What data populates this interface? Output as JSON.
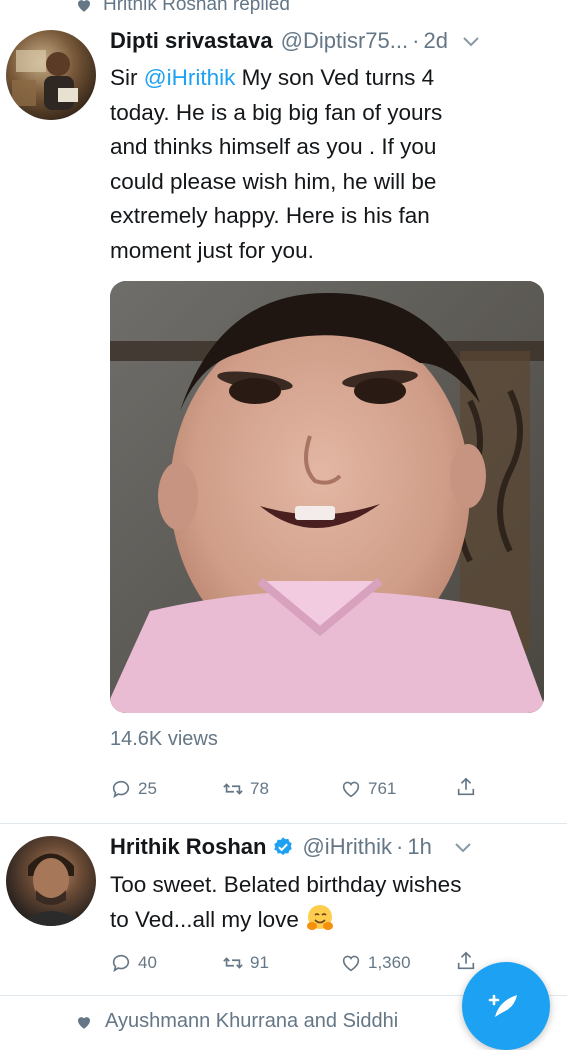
{
  "context": {
    "label": "Hrithik Roshan replied"
  },
  "tweet1": {
    "name": "Dipti srivastava",
    "handle": "@Diptisr75...",
    "time": "2d",
    "text_before": "Sir ",
    "mention": "@iHrithik",
    "text_line1_rest": " My son Ved turns 4",
    "text_line2": "today. He is a big big fan of yours",
    "text_line3": "and thinks himself as you . If you",
    "text_line4": "could please wish him, he will be",
    "text_line5": "extremely happy. Here is his fan",
    "text_line6": "moment just for you.",
    "views": "14.6K views",
    "replies": "25",
    "retweets": "78",
    "likes": "761"
  },
  "tweet2": {
    "name": "Hrithik Roshan",
    "handle": "@iHrithik",
    "time": "1h",
    "text_line1": "Too sweet. Belated birthday wishes",
    "text_line2": "to Ved...all my love",
    "replies": "40",
    "retweets": "91",
    "likes": "1,360"
  },
  "footer": {
    "label": "Ayushmann Khurrana and Siddhi"
  },
  "colors": {
    "accent": "#1da1f2",
    "muted": "#657786",
    "text": "#14171a"
  },
  "icons": [
    "heart-icon",
    "chevron-down-icon",
    "reply-icon",
    "retweet-icon",
    "like-icon",
    "share-icon",
    "verified-icon",
    "compose-icon",
    "hug-emoji-icon"
  ]
}
